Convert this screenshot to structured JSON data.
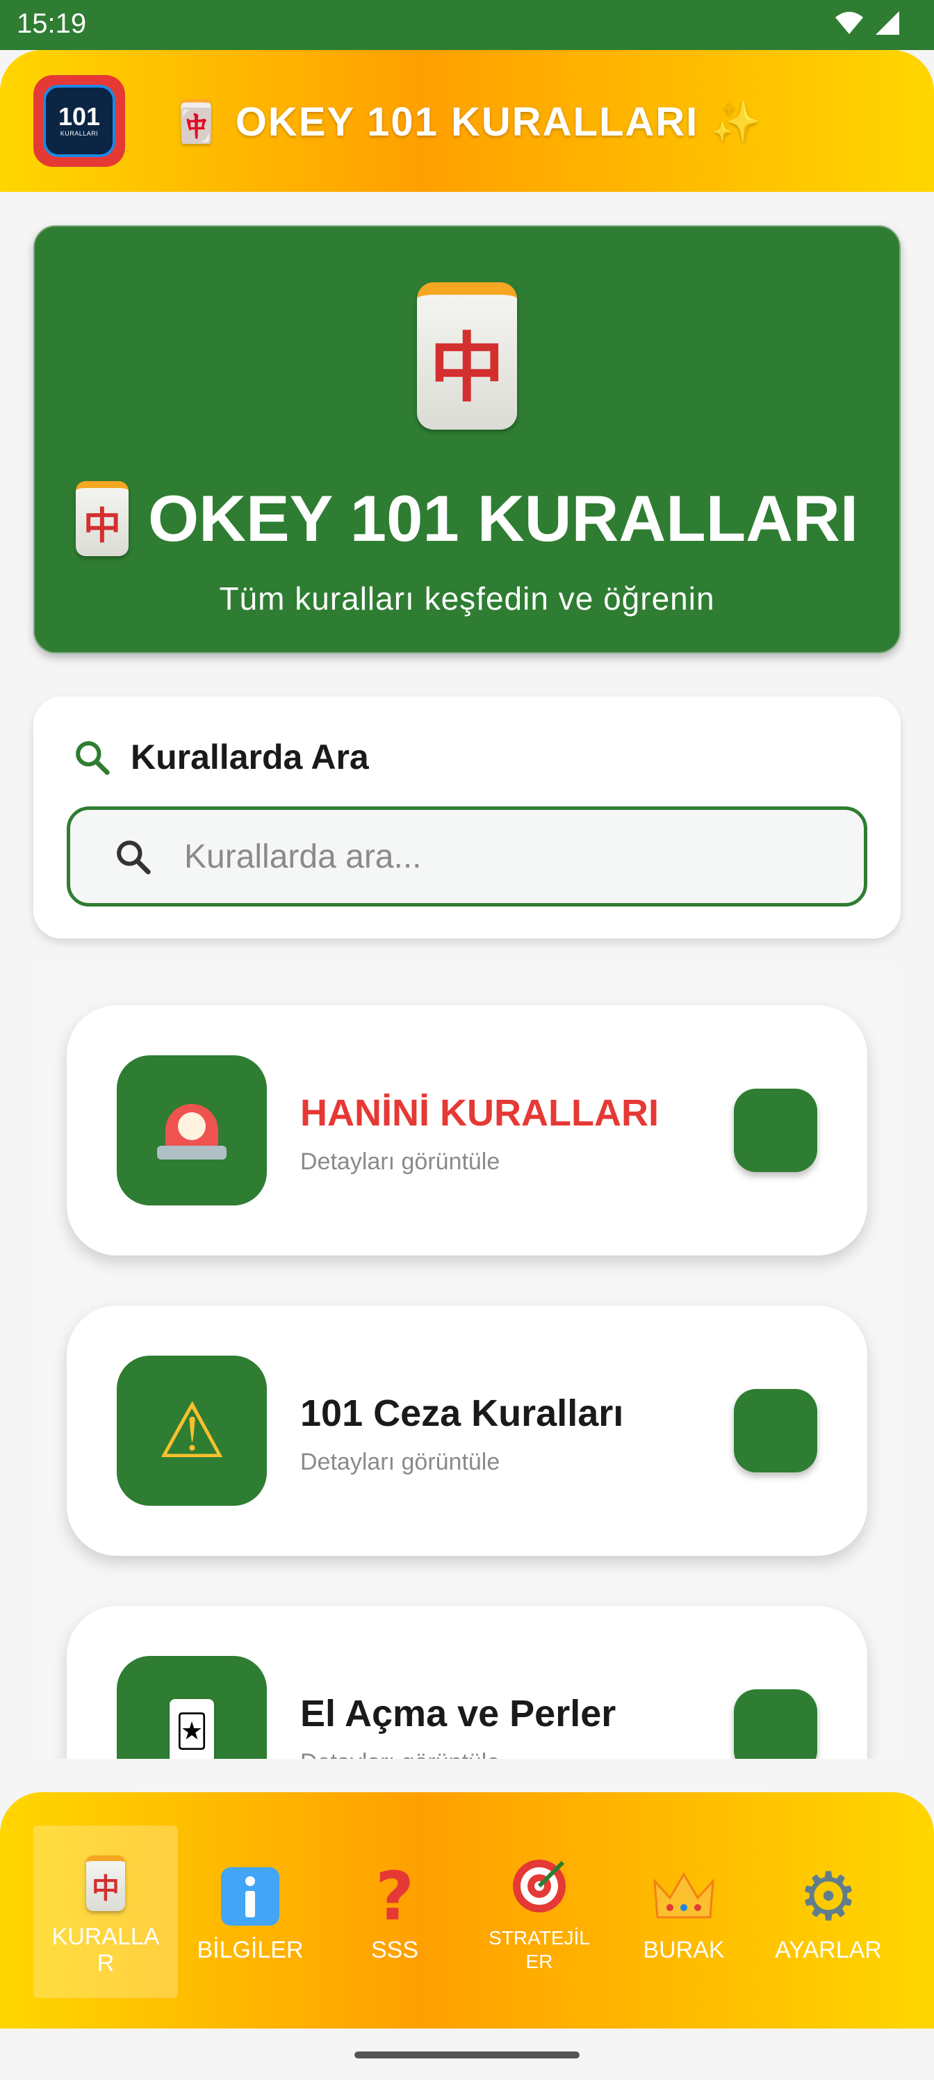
{
  "status_bar": {
    "time": "15:19"
  },
  "header": {
    "logo": {
      "number": "101",
      "caption": "KURALLARI"
    },
    "title": "🀄 OKEY 101 KURALLARI ✨"
  },
  "hero": {
    "tile_glyph": "中",
    "title": "OKEY 101 KURALLARI",
    "subtitle": "Tüm kuralları keşfedin ve öğrenin"
  },
  "search": {
    "heading": "Kurallarda Ara",
    "placeholder": "Kurallarda ara...",
    "value": ""
  },
  "rules": [
    {
      "title": "HANİNİ KURALLARI",
      "subtitle": "Detayları görüntüle",
      "icon": "siren-icon",
      "highlight": true
    },
    {
      "title": "101 Ceza Kuralları",
      "subtitle": "Detayları görüntüle",
      "icon": "warning-icon",
      "highlight": false
    },
    {
      "title": "El Açma ve Perler",
      "subtitle": "Detayları görüntüle",
      "icon": "joker-card-icon",
      "highlight": false
    }
  ],
  "bottom_nav": [
    {
      "label": "KURALLA\nR",
      "icon": "mahjong-tile-icon",
      "active": true
    },
    {
      "label": "BİLGİLER",
      "icon": "info-icon",
      "active": false
    },
    {
      "label": "SSS",
      "icon": "question-icon",
      "active": false
    },
    {
      "label": "STRATEJİL\nER",
      "icon": "target-icon",
      "active": false
    },
    {
      "label": "BURAK",
      "icon": "crown-icon",
      "active": false
    },
    {
      "label": "AYARLAR",
      "icon": "gear-icon",
      "active": false
    }
  ],
  "colors": {
    "primary_green": "#2e7d32",
    "accent_yellow": "#ffd600",
    "accent_orange": "#ffa000",
    "highlight_red": "#e53935"
  }
}
